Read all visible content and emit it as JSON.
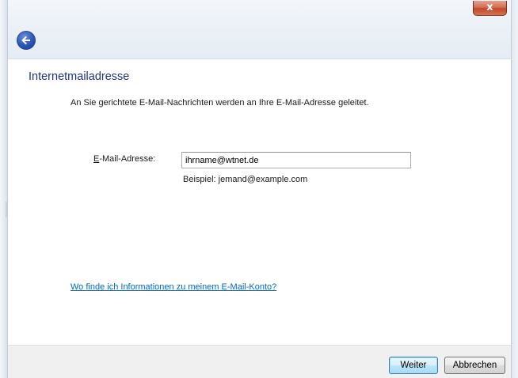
{
  "window": {
    "close_label": "x"
  },
  "page": {
    "heading": "Internetmailadresse",
    "description": "An Sie gerichtete E-Mail-Nachrichten werden an Ihre E-Mail-Adresse geleitet.",
    "email_label_accel": "E",
    "email_label_rest": "-Mail-Adresse:",
    "email_value": "ihrname@wtnet.de",
    "example": "Beispiel: jemand@example.com",
    "help_link": "Wo finde ich Informationen zu meinem E-Mail-Konto?"
  },
  "footer": {
    "next_label": "Weiter",
    "cancel_label": "Abbrechen"
  },
  "icons": {
    "back": "back-arrow-icon",
    "close": "close-icon"
  },
  "colors": {
    "heading": "#1e3287",
    "link": "#0066cc",
    "close_button": "#c4462a",
    "back_button": "#2c55b6"
  }
}
